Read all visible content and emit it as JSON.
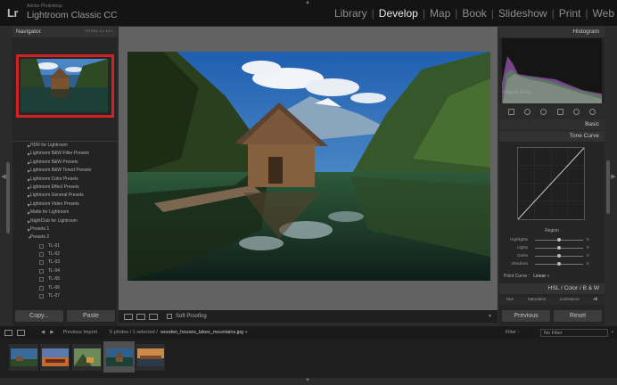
{
  "app": {
    "brand_line1": "Adobe Photoshop",
    "brand_line2": "Lightroom Classic CC",
    "logo": "Lr"
  },
  "modules": [
    "Library",
    "Develop",
    "Map",
    "Book",
    "Slideshow",
    "Print",
    "Web"
  ],
  "active_module": "Develop",
  "navigator": {
    "title": "Navigator",
    "zoom_options": "FIT   FILL   1:1   1:4 ÷"
  },
  "presets": [
    {
      "label": "HDR for Lightroom",
      "type": "folder"
    },
    {
      "label": "Lightroom B&W Filter Presets",
      "type": "folder"
    },
    {
      "label": "Lightroom B&W Presets",
      "type": "folder"
    },
    {
      "label": "Lightroom B&W Toned Presets",
      "type": "folder"
    },
    {
      "label": "Lightroom Color Presets",
      "type": "folder"
    },
    {
      "label": "Lightroom Effect Presets",
      "type": "folder"
    },
    {
      "label": "Lightroom General Presets",
      "type": "folder"
    },
    {
      "label": "Lightroom Video Presets",
      "type": "folder"
    },
    {
      "label": "Matte for Lightroom",
      "type": "folder"
    },
    {
      "label": "NightClub for Lightroom",
      "type": "folder"
    },
    {
      "label": "Presets 1",
      "type": "folder"
    },
    {
      "label": "Presets 2",
      "type": "open"
    },
    {
      "label": "TL-01",
      "type": "item"
    },
    {
      "label": "TL-02",
      "type": "item"
    },
    {
      "label": "TL-03",
      "type": "item"
    },
    {
      "label": "TL-04",
      "type": "item"
    },
    {
      "label": "TL-05",
      "type": "item"
    },
    {
      "label": "TL-06",
      "type": "item"
    },
    {
      "label": "TL-07",
      "type": "item"
    }
  ],
  "left_buttons": {
    "copy": "Copy...",
    "paste": "Paste"
  },
  "toolbar": {
    "soft_proofing": "Soft Proofing"
  },
  "right_panel": {
    "histogram": "Histogram",
    "original_photo": "Original Photo",
    "basic": "Basic",
    "tone_curve": "Tone Curve",
    "region": "Region",
    "sliders": [
      {
        "label": "Highlights",
        "value": "0",
        "pos": 0.5
      },
      {
        "label": "Lights",
        "value": "0",
        "pos": 0.5
      },
      {
        "label": "Darks",
        "value": "0",
        "pos": 0.5
      },
      {
        "label": "Shadows",
        "value": "0",
        "pos": 0.5
      }
    ],
    "point_curve_label": "Point Curve :",
    "point_curve_value": "Linear ÷",
    "hsl_header": "HSL  /  Color  /  B & W",
    "hsl_tabs": [
      "Hue",
      "Saturation",
      "Luminance",
      "All"
    ],
    "previous": "Previous",
    "reset": "Reset"
  },
  "filmstrip": {
    "page_labels": [
      "1",
      "2"
    ],
    "source": "Previous Import",
    "count": "5 photos / 1 selected /",
    "filename": "wooden_houses_lakes_mountains.jpg ÷",
    "filter_label": "Filter :",
    "filter_value": "No Filter",
    "thumbnails": 5,
    "selected_index": 3
  },
  "colors": {
    "highlight": "#d32020",
    "background": "#2b2b2b",
    "panel": "#252525"
  }
}
